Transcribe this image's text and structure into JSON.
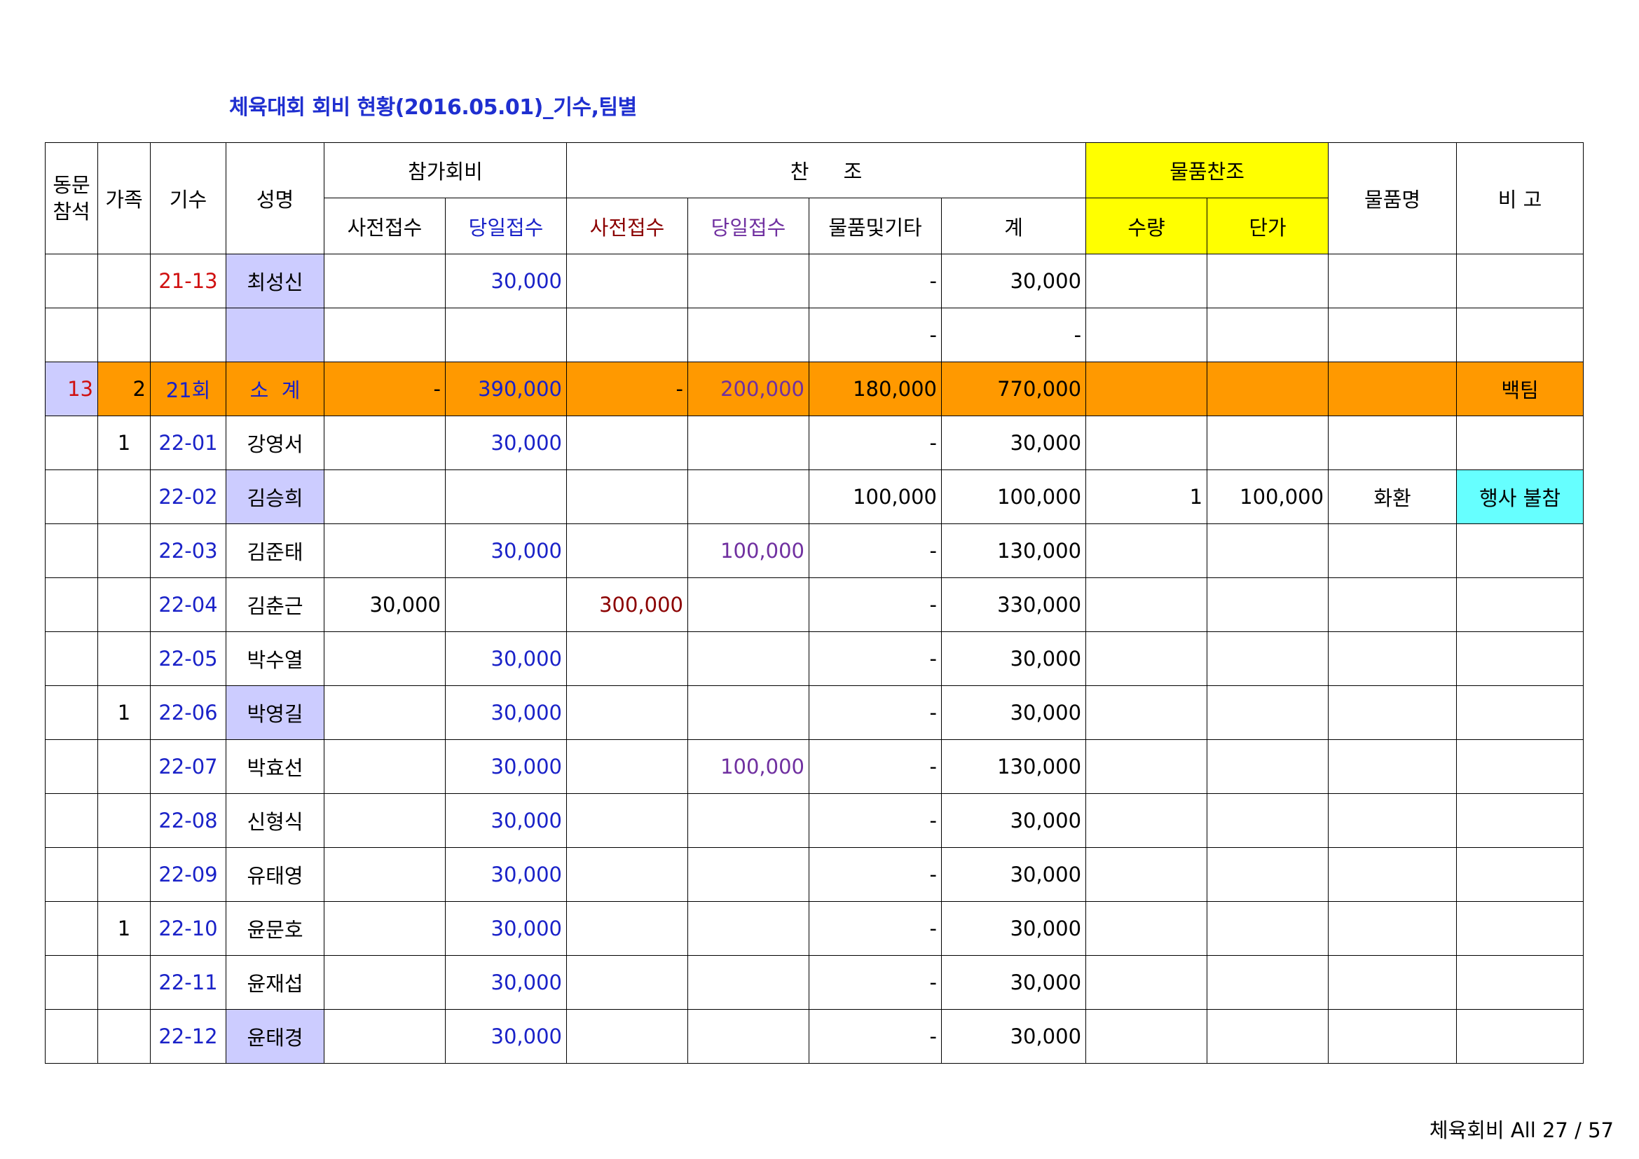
{
  "title": "체육대회 회비 현황(2016.05.01)_기수,팀별",
  "headers": {
    "attend": "동문\n참석",
    "family": "가족",
    "class_no": "기수",
    "name": "성명",
    "fee_group": "참가회비",
    "fee_pre": "사전접수",
    "fee_day": "당일접수",
    "support_group": "찬 조",
    "sup_pre": "사전접수",
    "sup_day": "당일접수",
    "sup_goods": "물품및기타",
    "total": "계",
    "goods_group": "물품찬조",
    "qty": "수량",
    "unit_price": "단가",
    "goods_name": "물품명",
    "note": "비 고"
  },
  "rows": [
    {
      "attend": "",
      "family": "",
      "class_no": "21-13",
      "name": "최성신",
      "fee_pre": "",
      "fee_day": "30,000",
      "sup_pre": "",
      "sup_day": "",
      "sup_goods": "-",
      "total": "30,000",
      "qty": "",
      "unit_price": "",
      "goods_name": "",
      "note": ""
    },
    {
      "attend": "",
      "family": "",
      "class_no": "",
      "name": "",
      "fee_pre": "",
      "fee_day": "",
      "sup_pre": "",
      "sup_day": "",
      "sup_goods": "-",
      "total": "-",
      "qty": "",
      "unit_price": "",
      "goods_name": "",
      "note": ""
    },
    {
      "attend": "13",
      "family": "2",
      "class_no": "21회",
      "name": "소  계",
      "fee_pre": "-",
      "fee_day": "390,000",
      "sup_pre": "-",
      "sup_day": "200,000",
      "sup_goods": "180,000",
      "total": "770,000",
      "qty": "",
      "unit_price": "",
      "goods_name": "",
      "note": "백팀"
    },
    {
      "attend": "",
      "family": "1",
      "class_no": "22-01",
      "name": "강영서",
      "fee_pre": "",
      "fee_day": "30,000",
      "sup_pre": "",
      "sup_day": "",
      "sup_goods": "-",
      "total": "30,000",
      "qty": "",
      "unit_price": "",
      "goods_name": "",
      "note": ""
    },
    {
      "attend": "",
      "family": "",
      "class_no": "22-02",
      "name": "김승희",
      "fee_pre": "",
      "fee_day": "",
      "sup_pre": "",
      "sup_day": "",
      "sup_goods": "100,000",
      "total": "100,000",
      "qty": "1",
      "unit_price": "100,000",
      "goods_name": "화환",
      "note": "행사 불참"
    },
    {
      "attend": "",
      "family": "",
      "class_no": "22-03",
      "name": "김준태",
      "fee_pre": "",
      "fee_day": "30,000",
      "sup_pre": "",
      "sup_day": "100,000",
      "sup_goods": "-",
      "total": "130,000",
      "qty": "",
      "unit_price": "",
      "goods_name": "",
      "note": ""
    },
    {
      "attend": "",
      "family": "",
      "class_no": "22-04",
      "name": "김춘근",
      "fee_pre": "30,000",
      "fee_day": "",
      "sup_pre": "300,000",
      "sup_day": "",
      "sup_goods": "-",
      "total": "330,000",
      "qty": "",
      "unit_price": "",
      "goods_name": "",
      "note": ""
    },
    {
      "attend": "",
      "family": "",
      "class_no": "22-05",
      "name": "박수열",
      "fee_pre": "",
      "fee_day": "30,000",
      "sup_pre": "",
      "sup_day": "",
      "sup_goods": "-",
      "total": "30,000",
      "qty": "",
      "unit_price": "",
      "goods_name": "",
      "note": ""
    },
    {
      "attend": "",
      "family": "1",
      "class_no": "22-06",
      "name": "박영길",
      "fee_pre": "",
      "fee_day": "30,000",
      "sup_pre": "",
      "sup_day": "",
      "sup_goods": "-",
      "total": "30,000",
      "qty": "",
      "unit_price": "",
      "goods_name": "",
      "note": ""
    },
    {
      "attend": "",
      "family": "",
      "class_no": "22-07",
      "name": "박효선",
      "fee_pre": "",
      "fee_day": "30,000",
      "sup_pre": "",
      "sup_day": "100,000",
      "sup_goods": "-",
      "total": "130,000",
      "qty": "",
      "unit_price": "",
      "goods_name": "",
      "note": ""
    },
    {
      "attend": "",
      "family": "",
      "class_no": "22-08",
      "name": "신형식",
      "fee_pre": "",
      "fee_day": "30,000",
      "sup_pre": "",
      "sup_day": "",
      "sup_goods": "-",
      "total": "30,000",
      "qty": "",
      "unit_price": "",
      "goods_name": "",
      "note": ""
    },
    {
      "attend": "",
      "family": "",
      "class_no": "22-09",
      "name": "유태영",
      "fee_pre": "",
      "fee_day": "30,000",
      "sup_pre": "",
      "sup_day": "",
      "sup_goods": "-",
      "total": "30,000",
      "qty": "",
      "unit_price": "",
      "goods_name": "",
      "note": ""
    },
    {
      "attend": "",
      "family": "1",
      "class_no": "22-10",
      "name": "윤문호",
      "fee_pre": "",
      "fee_day": "30,000",
      "sup_pre": "",
      "sup_day": "",
      "sup_goods": "-",
      "total": "30,000",
      "qty": "",
      "unit_price": "",
      "goods_name": "",
      "note": ""
    },
    {
      "attend": "",
      "family": "",
      "class_no": "22-11",
      "name": "윤재섭",
      "fee_pre": "",
      "fee_day": "30,000",
      "sup_pre": "",
      "sup_day": "",
      "sup_goods": "-",
      "total": "30,000",
      "qty": "",
      "unit_price": "",
      "goods_name": "",
      "note": ""
    },
    {
      "attend": "",
      "family": "",
      "class_no": "22-12",
      "name": "윤태경",
      "fee_pre": "",
      "fee_day": "30,000",
      "sup_pre": "",
      "sup_day": "",
      "sup_goods": "-",
      "total": "30,000",
      "qty": "",
      "unit_price": "",
      "goods_name": "",
      "note": ""
    }
  ],
  "footer": "체육회비 All 27 / 57",
  "colors": {
    "title": "#1f2fd0",
    "highlight_name": "#ccccff",
    "subtotal_row": "#ff9900",
    "goods_header": "#ffff00",
    "note_cyan": "#66ffff"
  }
}
